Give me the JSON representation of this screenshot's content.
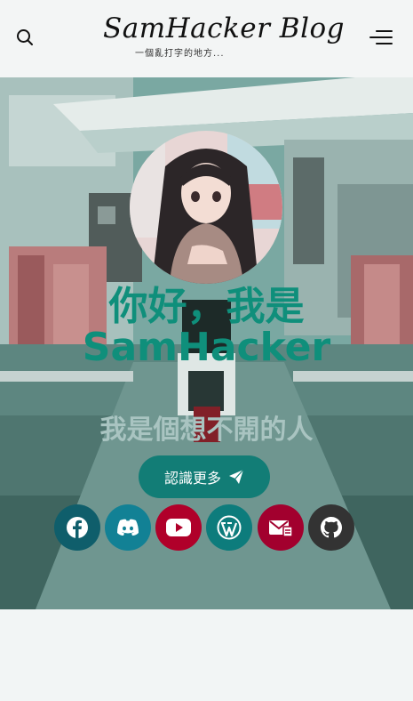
{
  "header": {
    "logo_title": "SamHacker Blog",
    "logo_tagline": "一個亂打字的地方..."
  },
  "hero": {
    "greeting": "你好，我是",
    "name": "SamHacker",
    "tagline": "我是個想不開的人",
    "cta_label": "認識更多"
  },
  "social": [
    {
      "name": "facebook",
      "icon": "facebook-icon",
      "color": "#0f5e6b"
    },
    {
      "name": "discord",
      "icon": "discord-icon",
      "color": "#128195"
    },
    {
      "name": "youtube",
      "icon": "youtube-icon",
      "color": "#b0002a"
    },
    {
      "name": "wordpress",
      "icon": "wordpress-icon",
      "color": "#0d7c7c"
    },
    {
      "name": "email",
      "icon": "mail-icon",
      "color": "#a2002e"
    },
    {
      "name": "github",
      "icon": "github-icon",
      "color": "#333333"
    }
  ]
}
